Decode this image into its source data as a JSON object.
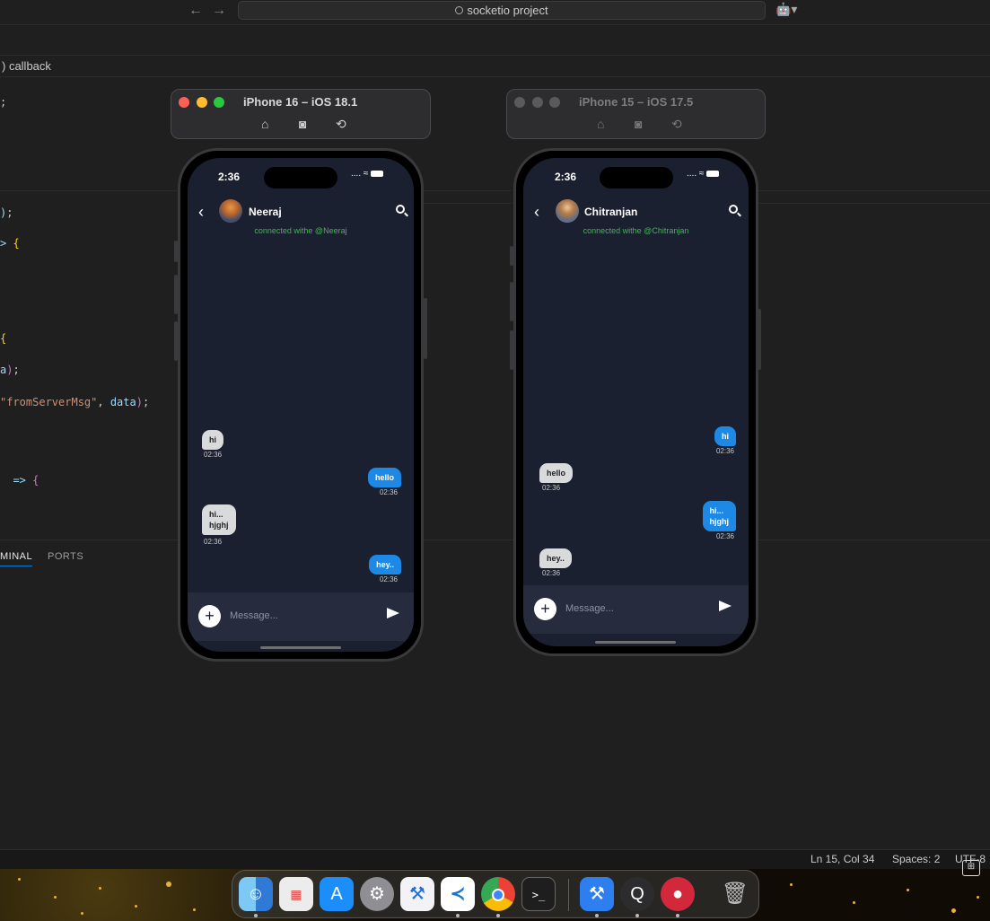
{
  "titlebar": {
    "back_arrow": "←",
    "forward_arrow": "→",
    "search_text": "socketio project",
    "copilot_icon": "🤖▾"
  },
  "editor": {
    "breadcrumb": ") callback",
    "code_lines": {
      "l1": ";",
      "l2_paren": ")",
      "l2_semi": ";",
      "l3_arrow": ">",
      "l3_brace": "{",
      "l4_brace": "{",
      "l5_var": "a",
      "l5_paren": ")",
      "l5_semi": ";",
      "l6_str": "\"fromServerMsg\"",
      "l6_comma": ", ",
      "l6_var": "data",
      "l6_paren": ")",
      "l6_semi": ";",
      "l7_arrow": "=>",
      "l7_brace": "{"
    }
  },
  "panel": {
    "tab_terminal": "MINAL",
    "tab_ports": "PORTS"
  },
  "statusbar": {
    "position": "Ln 15, Col 34",
    "spaces": "Spaces: 2",
    "encoding": "UTF-8"
  },
  "sim_left": {
    "title": "iPhone 16 – iOS 18.1",
    "time": "2:36",
    "signal": "....",
    "contact": "Neeraj",
    "connection_status": "connected withe @Neeraj",
    "messages": [
      {
        "text": "hi",
        "time": "02:36",
        "dir": "in"
      },
      {
        "text": "hello",
        "time": "02:36",
        "dir": "out"
      },
      {
        "text": "hi...\nhjghj",
        "time": "02:36",
        "dir": "in"
      },
      {
        "text": "hey..",
        "time": "02:36",
        "dir": "out"
      }
    ],
    "input_placeholder": "Message..."
  },
  "sim_right": {
    "title": "iPhone 15 – iOS 17.5",
    "time": "2:36",
    "signal": "....",
    "contact": "Chitranjan",
    "connection_status": "connected withe @Chitranjan",
    "messages": [
      {
        "text": "hi",
        "time": "02:36",
        "dir": "out"
      },
      {
        "text": "hello",
        "time": "02:36",
        "dir": "in"
      },
      {
        "text": "hi...\nhjghj",
        "time": "02:36",
        "dir": "out"
      },
      {
        "text": "hey..",
        "time": "02:36",
        "dir": "in"
      }
    ],
    "input_placeholder": "Message..."
  },
  "sim_toolbar_icons": [
    "home-icon",
    "screenshot-icon",
    "rotate-icon"
  ],
  "dock": {
    "apps": [
      "finder",
      "launchpad",
      "app-store",
      "system-settings",
      "instruments",
      "vscode",
      "chrome",
      "terminal",
      "xcode",
      "quicktime",
      "screen-recorder",
      "trash"
    ]
  },
  "colors": {
    "accent": "#0078d4",
    "outgoing_bubble": "#1e88e5",
    "incoming_bubble": "#d9dadc",
    "connected_text": "#3fb950",
    "chat_bg": "#1b2030"
  }
}
